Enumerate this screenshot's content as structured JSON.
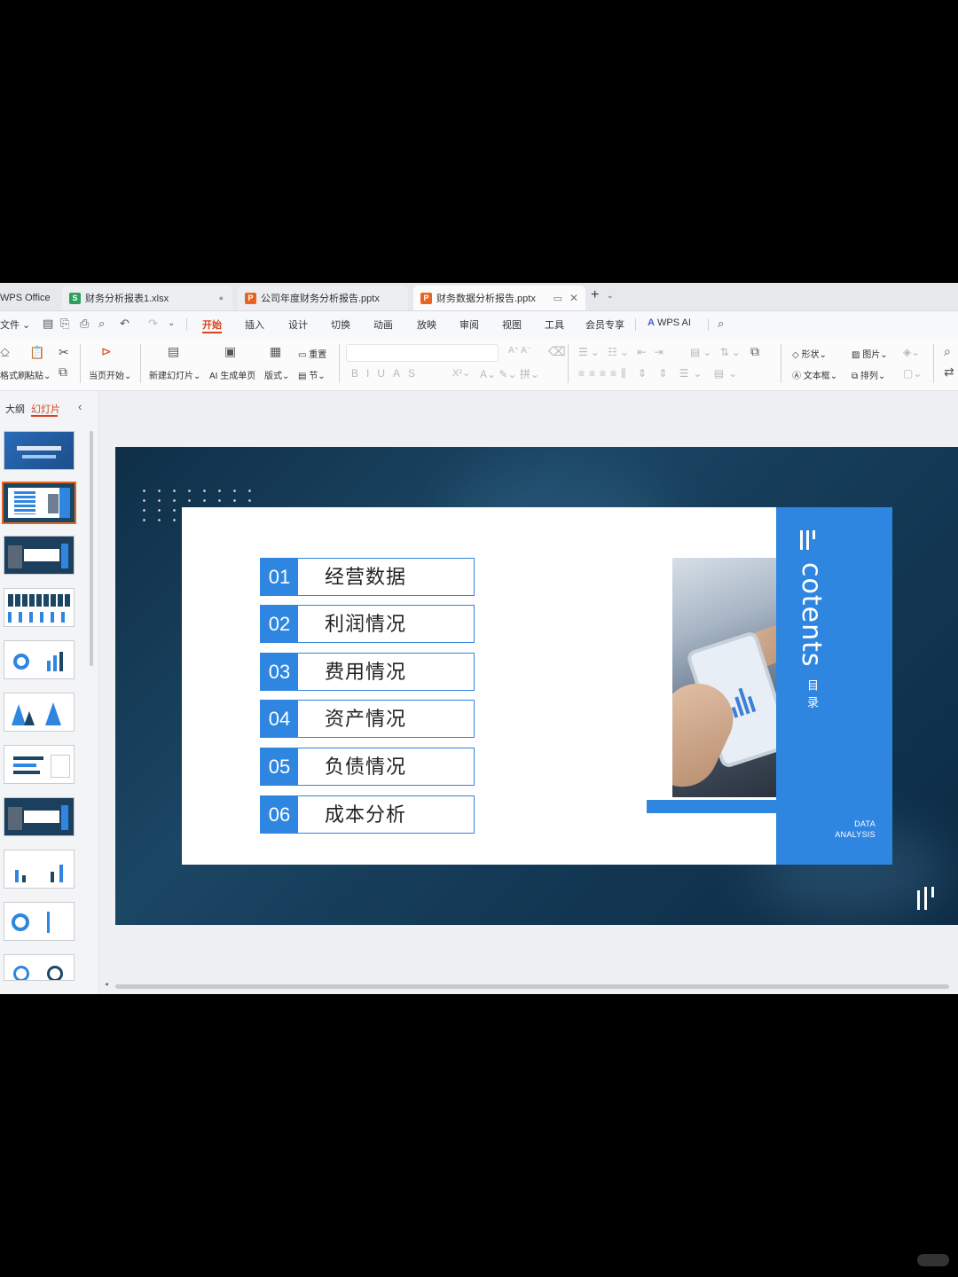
{
  "tabbar": {
    "home": "WPS Office",
    "tabs": [
      {
        "label": "财务分析报表1.xlsx",
        "icon": "S"
      },
      {
        "label": "公司年度财务分析报告.pptx",
        "icon": "P"
      },
      {
        "label": "财务数据分析报告.pptx",
        "icon": "P"
      }
    ],
    "new_tab": "+"
  },
  "menubar": {
    "file": "文件",
    "items": [
      "开始",
      "插入",
      "设计",
      "切换",
      "动画",
      "放映",
      "审阅",
      "视图",
      "工具",
      "会员专享"
    ],
    "wps_ai": "WPS AI"
  },
  "ribbon": {
    "format_painter": "格式刷",
    "paste": "粘贴",
    "from_current": "当页开始",
    "new_slide": "新建幻灯片",
    "ai_page": "AI 生成单页",
    "layout": "版式",
    "reset": "重置",
    "section": "节",
    "shape": "形状",
    "image": "图片",
    "textbox": "文本框",
    "arrange": "排列"
  },
  "leftpanel": {
    "tab_outline": "大纲",
    "tab_slides": "幻灯片"
  },
  "slide": {
    "title": "cotents",
    "subtitle": "目录",
    "footer_line1": "DATA",
    "footer_line2": "ANALYSIS",
    "items": [
      {
        "num": "01",
        "label": "经营数据"
      },
      {
        "num": "02",
        "label": "利润情况"
      },
      {
        "num": "03",
        "label": "费用情况"
      },
      {
        "num": "04",
        "label": "资产情况"
      },
      {
        "num": "05",
        "label": "负债情况"
      },
      {
        "num": "06",
        "label": "成本分析"
      }
    ]
  },
  "colors": {
    "accent": "#2f86e0",
    "active_tab": "#d4461f",
    "slide_bg": "#1b4664"
  }
}
